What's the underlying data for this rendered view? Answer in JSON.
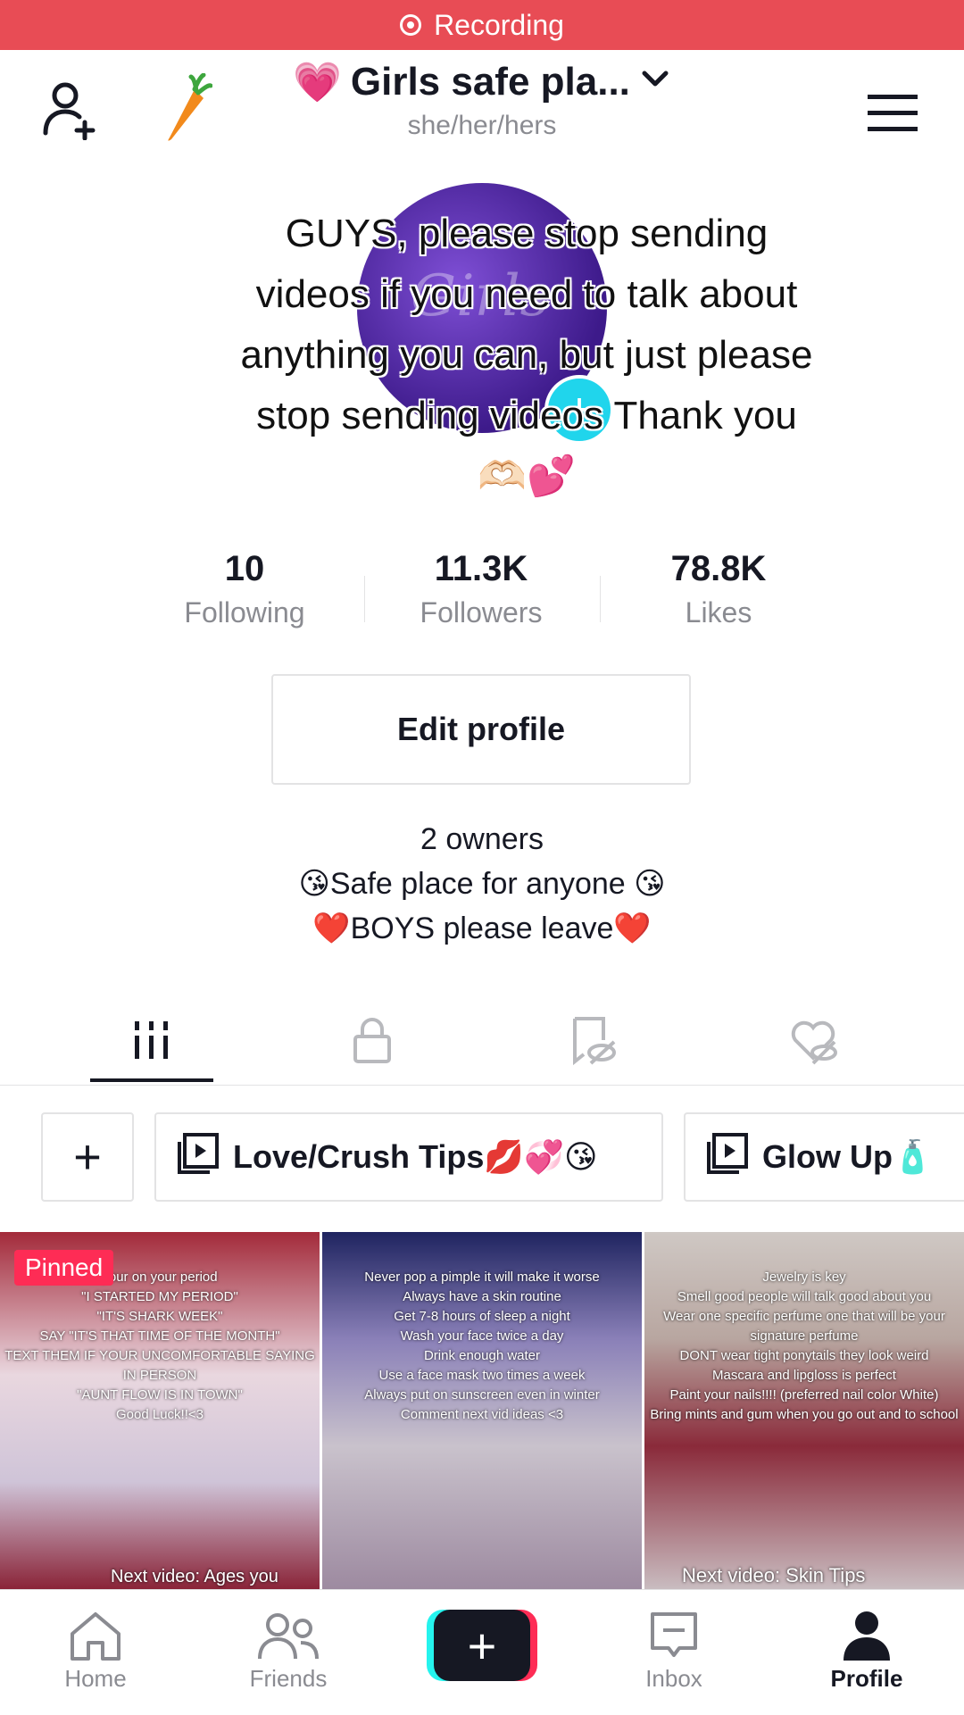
{
  "recording": {
    "label": "Recording"
  },
  "header": {
    "title_emoji": "💗",
    "title": "Girls safe pla...",
    "pronouns": "she/her/hers"
  },
  "overlay": {
    "text": "GUYS, please stop sending videos if you need to talk about anything you can, but just please stop sending videos Thank you🫶🏻💕"
  },
  "stats": [
    {
      "value": "10",
      "label": "Following"
    },
    {
      "value": "11.3K",
      "label": "Followers"
    },
    {
      "value": "78.8K",
      "label": "Likes"
    }
  ],
  "edit_profile_label": "Edit profile",
  "bio": {
    "line1": "2 owners",
    "line2": "😘Safe place for anyone 😘",
    "line3": "❤️BOYS please leave❤️"
  },
  "playlists": {
    "add_label": "+",
    "items": [
      {
        "label": "Love/Crush Tips💋💞😘"
      },
      {
        "label": "Glow Up🧴"
      }
    ]
  },
  "videos": [
    {
      "pinned_label": "Pinned",
      "text": "your on your period\n\"I STARTED MY PERIOD\"\n\"IT'S SHARK WEEK\"\nSAY \"IT'S THAT TIME OF THE MONTH\"\nTEXT THEM IF YOUR UNCOMFORTABLE SAYING IN PERSON\n\"AUNT FLOW IS IN TOWN\"\nGood Luck!!<3",
      "next": "Next video: Ages you"
    },
    {
      "text": "Never pop a pimple it will make it worse\nAlways have a skin routine\nGet 7-8 hours of sleep a night\nWash your face twice a day\nDrink enough water\nUse a face mask two times a week\nAlways put on sunscreen even in winter\nComment next vid ideas <3",
      "next": ""
    },
    {
      "text": "Jewelry is key\nSmell good people will talk good about you\nWear one specific perfume one that will be your signature perfume\nDONT wear tight ponytails they look weird\nMascara and lipgloss is perfect\nPaint your nails!!!! (preferred nail color White)\nBring mints and gum when you go out and to school",
      "next": "Next video: Skin Tips"
    }
  ],
  "nav": [
    {
      "label": "Home",
      "icon": "home-icon"
    },
    {
      "label": "Friends",
      "icon": "friends-icon"
    },
    {
      "label": "",
      "icon": "plus-icon"
    },
    {
      "label": "Inbox",
      "icon": "inbox-icon"
    },
    {
      "label": "Profile",
      "icon": "profile-icon"
    }
  ],
  "colors": {
    "accent": "#fe2c55",
    "cyan": "#25f4ee",
    "recording_bar": "#e84c55"
  }
}
